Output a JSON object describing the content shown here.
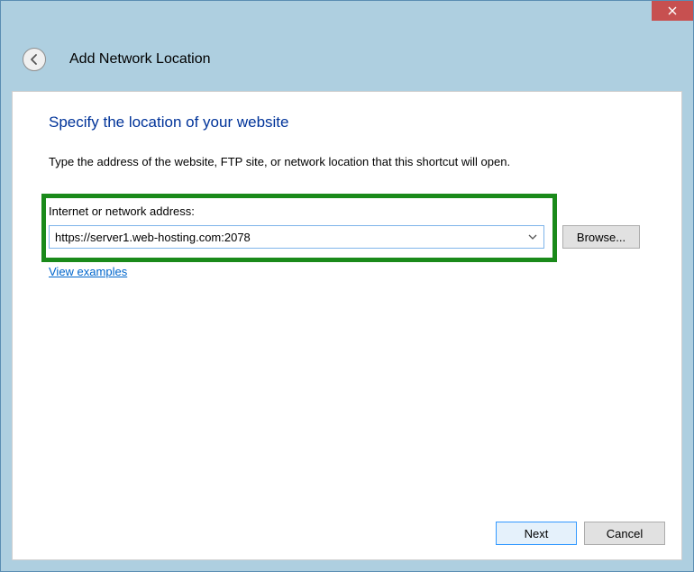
{
  "titlebar": {
    "close_label": "Close"
  },
  "header": {
    "wizard_title": "Add Network Location"
  },
  "content": {
    "heading": "Specify the location of your website",
    "instruction": "Type the address of the website, FTP site, or network location that this shortcut will open.",
    "address_label": "Internet or network address:",
    "address_value": "https://server1.web-hosting.com:2078",
    "browse_label": "Browse...",
    "examples_link": "View examples"
  },
  "footer": {
    "next_label": "Next",
    "cancel_label": "Cancel"
  }
}
